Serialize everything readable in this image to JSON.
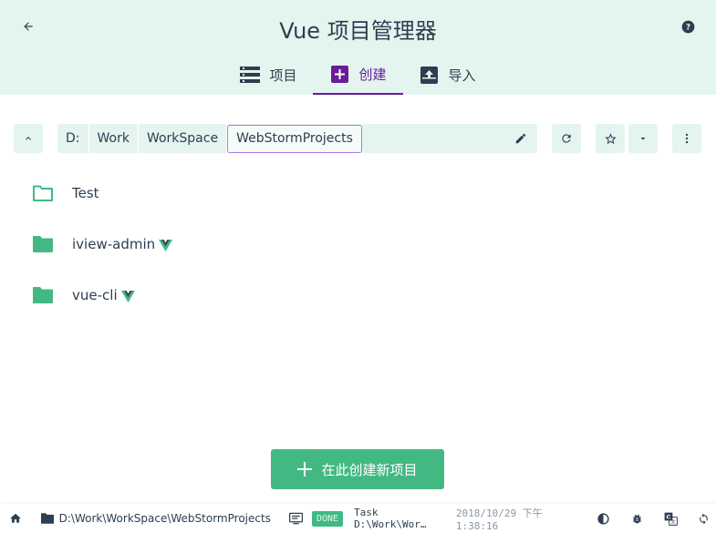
{
  "header": {
    "title": "Vue 项目管理器",
    "back_icon": "arrow-left-icon",
    "help_icon": "help-circle-icon"
  },
  "tabs": [
    {
      "label": "项目",
      "icon": "list-icon",
      "active": false
    },
    {
      "label": "创建",
      "icon": "add-box-icon",
      "active": true
    },
    {
      "label": "导入",
      "icon": "unarchive-icon",
      "active": false
    }
  ],
  "toolbar": {
    "breadcrumbs": [
      "D:",
      "Work",
      "WorkSpace",
      "WebStormProjects"
    ]
  },
  "folders": [
    {
      "name": "Test",
      "icon": "folder-outline-icon",
      "vue_project": false
    },
    {
      "name": "iview-admin",
      "icon": "folder-icon",
      "vue_project": true
    },
    {
      "name": "vue-cli",
      "icon": "folder-icon",
      "vue_project": true
    }
  ],
  "create_button": {
    "label": "在此创建新项目"
  },
  "statusbar": {
    "cwd": "D:\\Work\\WorkSpace\\WebStormProjects",
    "task_status": "DONE",
    "task_text": "Task D:\\Work\\Wor…",
    "task_time": "2018/10/29 下午1:38:16"
  },
  "colors": {
    "header_bg": "#e4f5ef",
    "accent_purple": "#6a1b9a",
    "vue_green": "#42b983",
    "text": "#2c3e50"
  }
}
